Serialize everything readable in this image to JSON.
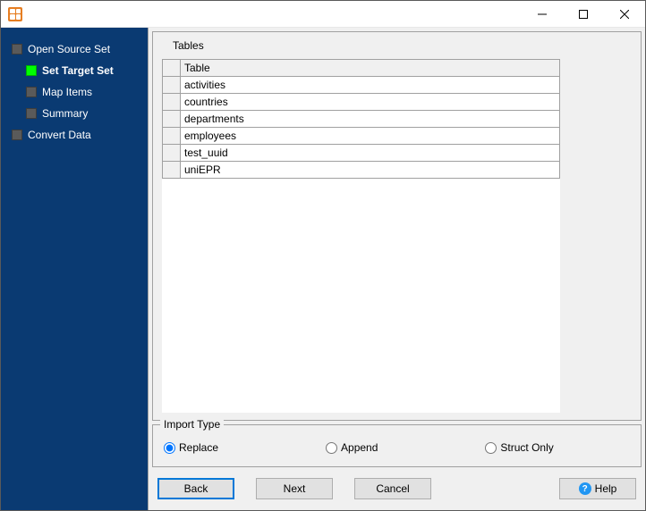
{
  "sidebar": {
    "items": [
      {
        "label": "Open Source Set",
        "sub": false,
        "active": false
      },
      {
        "label": "Set Target Set",
        "sub": true,
        "active": true
      },
      {
        "label": "Map Items",
        "sub": true,
        "active": false
      },
      {
        "label": "Summary",
        "sub": true,
        "active": false
      },
      {
        "label": "Convert Data",
        "sub": false,
        "active": false
      }
    ]
  },
  "tables": {
    "section_label": "Tables",
    "column_header": "Table",
    "rows": [
      "activities",
      "countries",
      "departments",
      "employees",
      "test_uuid",
      "uniEPR"
    ]
  },
  "import": {
    "legend": "Import Type",
    "options": [
      {
        "label": "Replace",
        "checked": true
      },
      {
        "label": "Append",
        "checked": false
      },
      {
        "label": "Struct Only",
        "checked": false
      }
    ]
  },
  "buttons": {
    "back": "Back",
    "next": "Next",
    "cancel": "Cancel",
    "help": "Help"
  }
}
